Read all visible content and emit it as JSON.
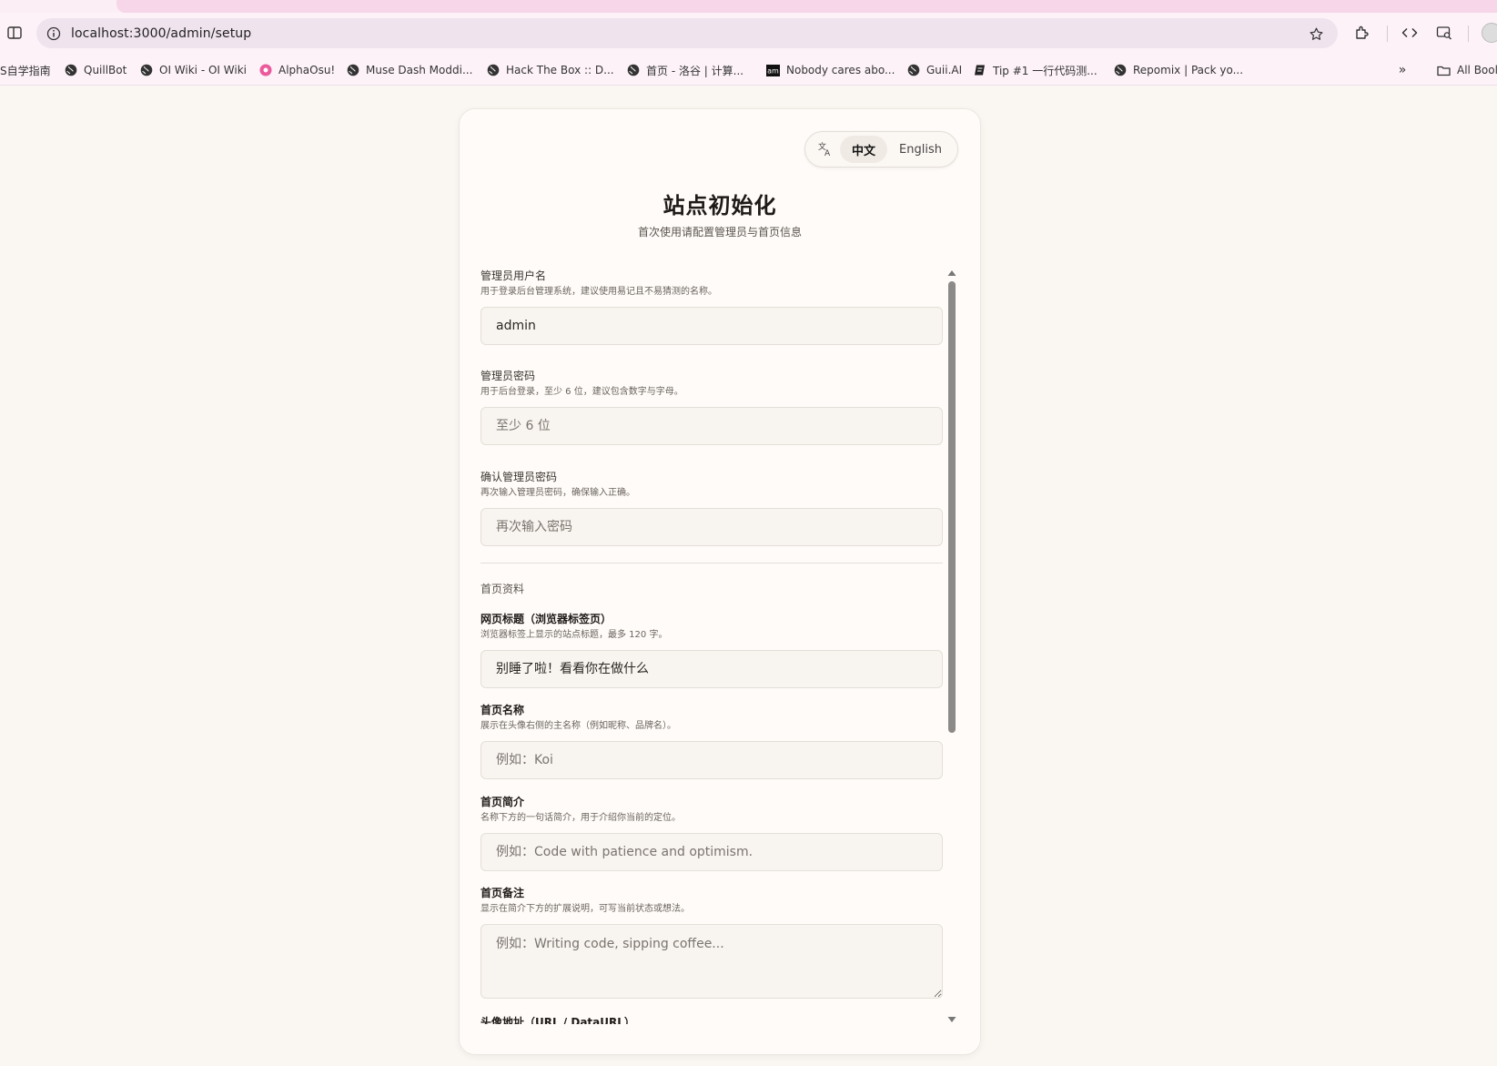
{
  "browser": {
    "url": "localhost:3000/admin/setup",
    "bookmarks": [
      {
        "label": "S自学指南",
        "icon": "none"
      },
      {
        "label": "QuillBot",
        "icon": "globe-icon"
      },
      {
        "label": "OI Wiki - OI Wiki",
        "icon": "globe-icon"
      },
      {
        "label": "AlphaOsu!",
        "icon": "alphaosu-icon"
      },
      {
        "label": "Muse Dash Moddi...",
        "icon": "globe-icon"
      },
      {
        "label": "Hack The Box :: D...",
        "icon": "globe-icon"
      },
      {
        "label": "首页 - 洛谷 | 计算...",
        "icon": "globe-icon"
      },
      {
        "label": "Nobody cares abo...",
        "icon": "am-icon"
      },
      {
        "label": "Guii.AI",
        "icon": "globe-icon"
      },
      {
        "label": "Tip #1 一行代码测...",
        "icon": "note-icon"
      },
      {
        "label": "Repomix | Pack yo...",
        "icon": "globe-icon"
      }
    ],
    "all_bookmarks_label": "All Bool"
  },
  "lang_switch": {
    "zh_label": "中文",
    "en_label": "English",
    "active": "zh"
  },
  "header": {
    "title": "站点初始化",
    "subtitle": "首次使用请配置管理员与首页信息"
  },
  "form": {
    "admin_username": {
      "label": "管理员用户名",
      "hint": "用于登录后台管理系统，建议使用易记且不易猜测的名称。",
      "value": "admin"
    },
    "admin_password": {
      "label": "管理员密码",
      "hint": "用于后台登录，至少 6 位，建议包含数字与字母。",
      "placeholder": "至少 6 位"
    },
    "confirm_password": {
      "label": "确认管理员密码",
      "hint": "再次输入管理员密码，确保输入正确。",
      "placeholder": "再次输入密码"
    },
    "section_homepage": "首页资料",
    "page_title": {
      "label": "网页标题（浏览器标签页）",
      "hint": "浏览器标签上显示的站点标题，最多 120 字。",
      "placeholder": "别睡了啦！看看你在做什么"
    },
    "home_name": {
      "label": "首页名称",
      "hint": "展示在头像右侧的主名称（例如昵称、品牌名）。",
      "placeholder": "例如：Koi"
    },
    "home_bio": {
      "label": "首页简介",
      "hint": "名称下方的一句话简介，用于介绍你当前的定位。",
      "placeholder": "例如：Code with patience and optimism."
    },
    "home_note": {
      "label": "首页备注",
      "hint": "显示在简介下方的扩展说明，可写当前状态或想法。",
      "placeholder": "例如：Writing code, sipping coffee..."
    },
    "avatar_url": {
      "label": "头像地址（URL / DataURL）"
    }
  },
  "colors": {
    "page_bg": "#faf7f3",
    "card_bg": "#fffbf8",
    "input_bg": "#f8f4ef",
    "browser_bar": "#fdf2f8",
    "scroll_thumb": "#8c8a88"
  }
}
